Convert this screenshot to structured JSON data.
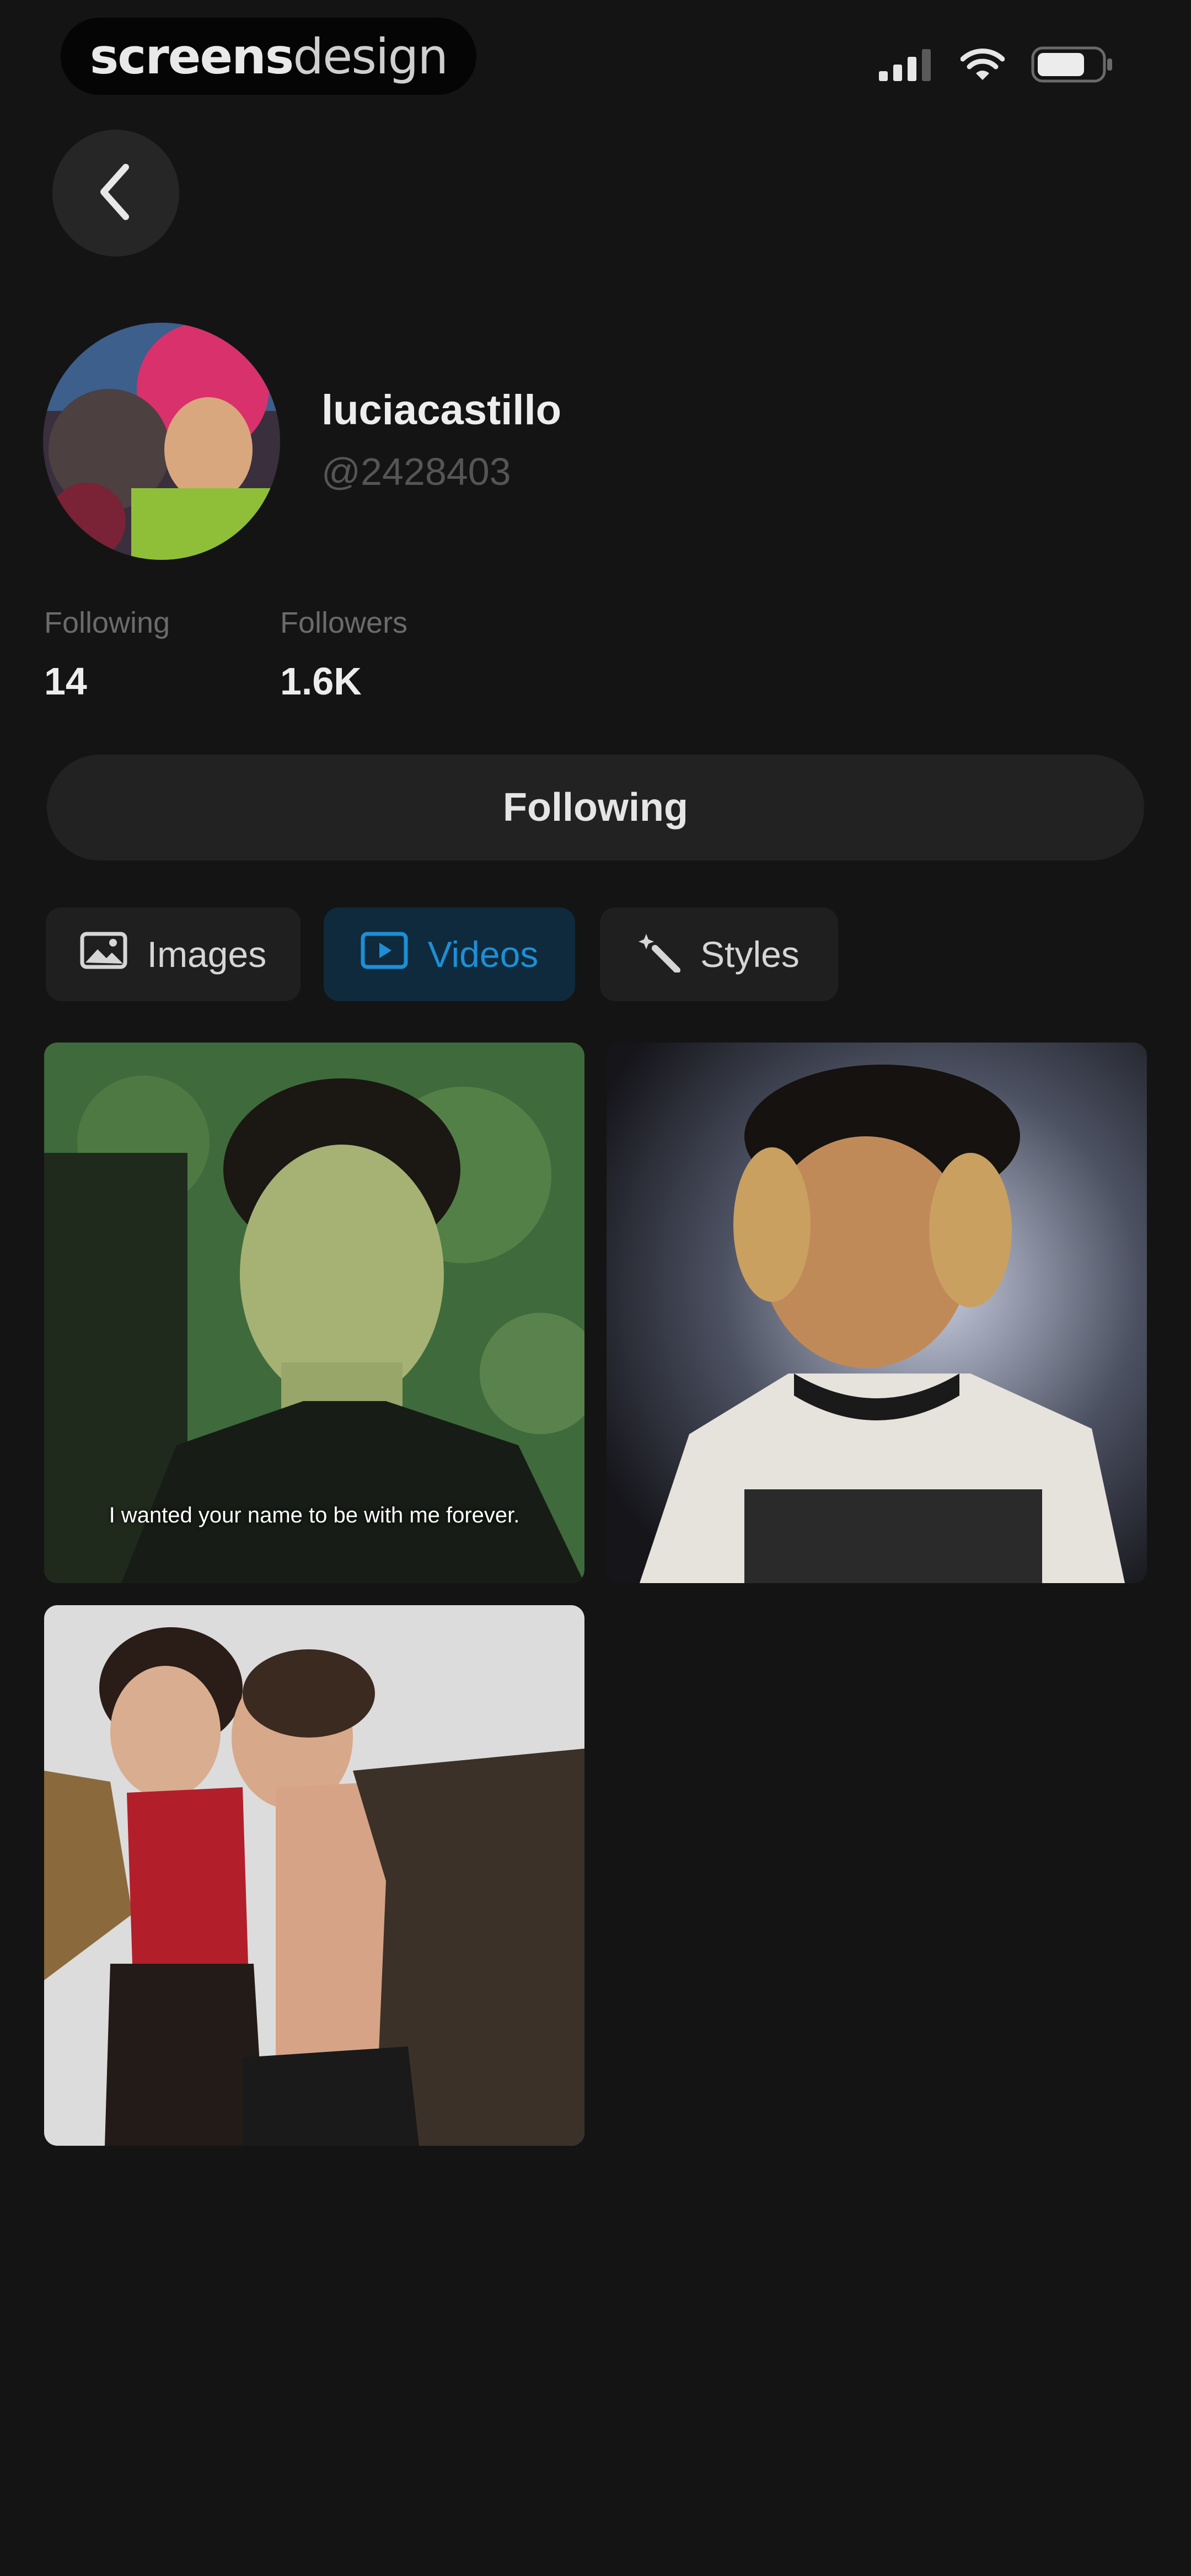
{
  "status_bar": {
    "brand_bold": "screens",
    "brand_light": "design",
    "icons": [
      "signal-icon",
      "wifi-icon",
      "battery-icon"
    ]
  },
  "nav": {
    "back_icon": "chevron-left-icon"
  },
  "profile": {
    "display_name": "luciacastillo",
    "handle": "@2428403",
    "stats": [
      {
        "label": "Following",
        "value": "14"
      },
      {
        "label": "Followers",
        "value": "1.6K"
      }
    ],
    "follow_button_label": "Following"
  },
  "tabs": [
    {
      "label": "Images",
      "icon": "image-icon",
      "active": false
    },
    {
      "label": "Videos",
      "icon": "video-icon",
      "active": true
    },
    {
      "label": "Styles",
      "icon": "magic-wand-icon",
      "active": false
    }
  ],
  "media": [
    {
      "caption": "I wanted your name to be with me forever."
    },
    {
      "caption": ""
    },
    {
      "caption": ""
    }
  ],
  "colors": {
    "background": "#141414",
    "surface": "#222222",
    "accent": "#1d8fd6",
    "accent_bg": "#0f2a3c"
  }
}
